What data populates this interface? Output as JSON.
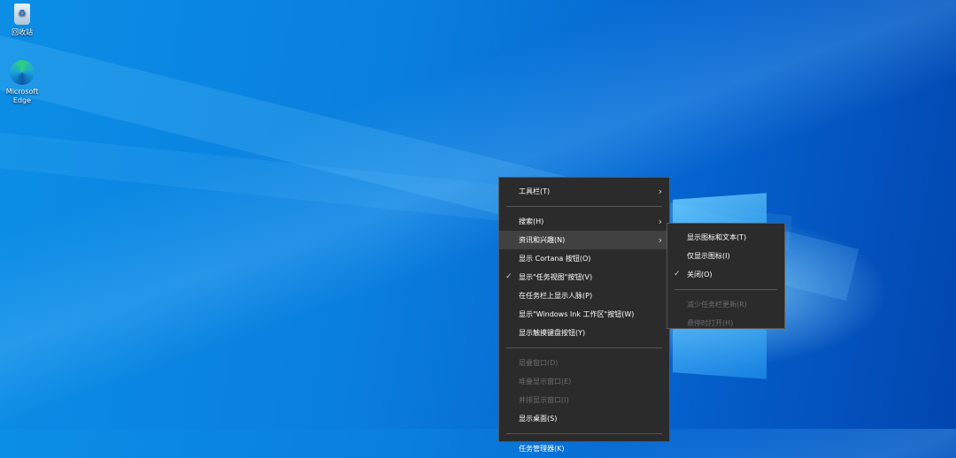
{
  "desktop": {
    "icons": [
      {
        "label": "回收站",
        "icon": "recycle-bin-icon"
      },
      {
        "label": "Microsoft Edge",
        "icon": "edge-icon"
      }
    ]
  },
  "context_menu": {
    "items": [
      {
        "label": "工具栏(T)",
        "submenu": true
      },
      {
        "label": "搜索(H)",
        "submenu": true
      },
      {
        "label": "资讯和兴趣(N)",
        "submenu": true,
        "highlighted": true
      },
      {
        "label": "显示 Cortana 按钮(O)"
      },
      {
        "label": "显示\"任务视图\"按钮(V)",
        "checked": true
      },
      {
        "label": "在任务栏上显示人脉(P)"
      },
      {
        "label": "显示\"Windows Ink 工作区\"按钮(W)"
      },
      {
        "label": "显示触摸键盘按钮(Y)"
      },
      {
        "label": "层叠窗口(D)",
        "disabled": true
      },
      {
        "label": "堆叠显示窗口(E)",
        "disabled": true
      },
      {
        "label": "并排显示窗口(I)",
        "disabled": true
      },
      {
        "label": "显示桌面(S)"
      },
      {
        "label": "任务管理器(K)"
      }
    ]
  },
  "submenu": {
    "items": [
      {
        "label": "显示图标和文本(T)"
      },
      {
        "label": "仅显示图标(I)"
      },
      {
        "label": "关闭(O)",
        "checked": true
      },
      {
        "label": "减少任务栏更新(R)",
        "disabled": true
      },
      {
        "label": "悬停时打开(H)",
        "disabled": true
      }
    ]
  },
  "glyphs": {
    "chevron": "›",
    "check": "✓"
  }
}
